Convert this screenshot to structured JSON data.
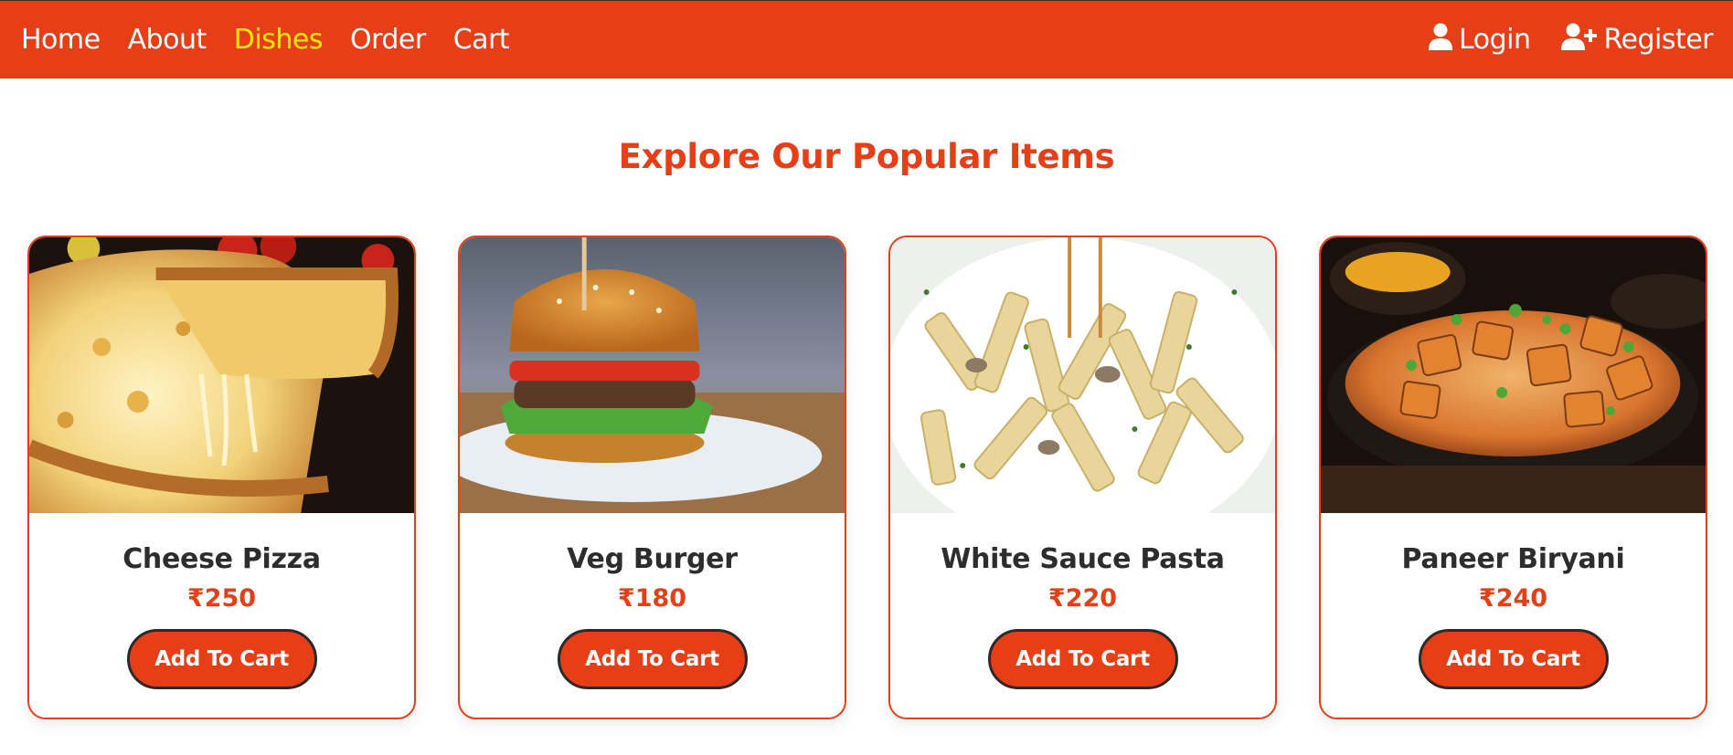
{
  "nav": {
    "links": [
      {
        "label": "Home"
      },
      {
        "label": "About"
      },
      {
        "label": "Dishes",
        "active": true
      },
      {
        "label": "Order"
      },
      {
        "label": "Cart"
      }
    ],
    "login_label": "Login",
    "register_label": "Register"
  },
  "main": {
    "title": "Explore Our Popular Items",
    "items": [
      {
        "name": "Cheese Pizza",
        "price": "₹250",
        "button": "Add To Cart",
        "image": "cheese-pizza-photo"
      },
      {
        "name": "Veg Burger",
        "price": "₹180",
        "button": "Add To Cart",
        "image": "veg-burger-photo"
      },
      {
        "name": "White Sauce Pasta",
        "price": "₹220",
        "button": "Add To Cart",
        "image": "white-sauce-pasta-photo"
      },
      {
        "name": "Paneer Biryani",
        "price": "₹240",
        "button": "Add To Cart",
        "image": "paneer-biryani-photo"
      }
    ]
  },
  "colors": {
    "brand": "#e63f17",
    "active_link": "#ffe800",
    "text": "#2d2d2d"
  },
  "icons": {
    "login": "user-icon",
    "register": "user-plus-icon"
  }
}
